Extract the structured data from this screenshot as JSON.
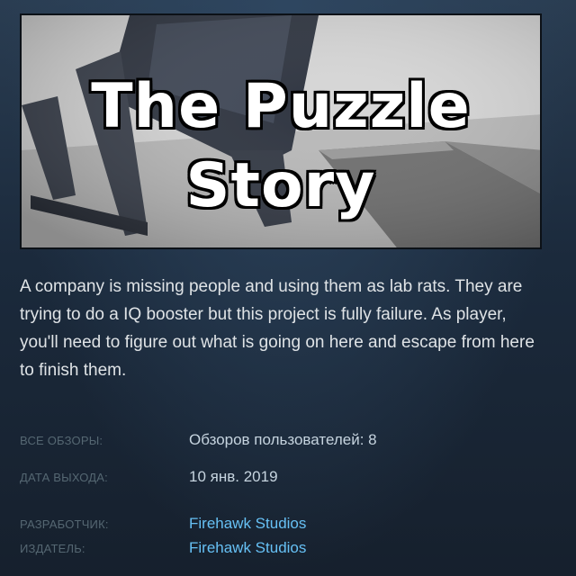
{
  "game": {
    "title_line1": "The Puzzle",
    "title_line2": "Story",
    "description": "A company is missing people and using them as lab rats. They are trying to do a IQ booster but this project is fully failure. As player, you'll need to figure out what is going on here and escape from here to finish them."
  },
  "meta": {
    "reviews_label": "ВСЕ ОБЗОРЫ:",
    "reviews_value": "Обзоров пользователей: 8",
    "release_label": "ДАТА ВЫХОДА:",
    "release_value": "10 янв. 2019",
    "developer_label": "РАЗРАБОТЧИК:",
    "developer_value": "Firehawk Studios",
    "publisher_label": "ИЗДАТЕЛЬ:",
    "publisher_value": "Firehawk Studios"
  },
  "colors": {
    "background": "#1b2838",
    "link": "#66c0f4",
    "label": "#556772",
    "text": "#c6d4df"
  }
}
